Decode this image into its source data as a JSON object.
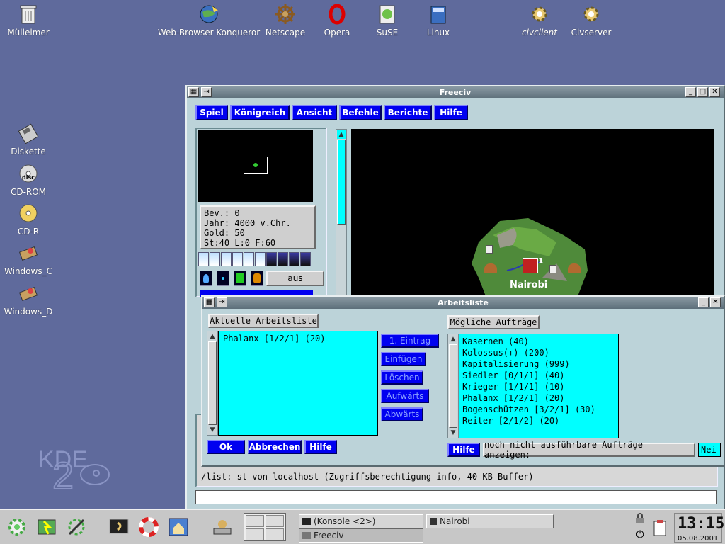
{
  "desktop": {
    "top_icons": [
      {
        "label": "Mülleimer",
        "icon": "trash-icon"
      },
      {
        "label": "Web-Browser Konqueror",
        "icon": "konqueror-icon"
      },
      {
        "label": "Netscape",
        "icon": "netscape-icon"
      },
      {
        "label": "Opera",
        "icon": "opera-icon"
      },
      {
        "label": "SuSE",
        "icon": "suse-icon"
      },
      {
        "label": "Linux",
        "icon": "folder-icon"
      },
      {
        "label": "civclient",
        "icon": "gear-icon"
      },
      {
        "label": "Civserver",
        "icon": "gear-icon"
      }
    ],
    "left_icons": [
      {
        "label": "Diskette",
        "icon": "floppy-icon"
      },
      {
        "label": "CD-ROM",
        "icon": "cdrom-icon"
      },
      {
        "label": "CD-R",
        "icon": "cdr-icon"
      },
      {
        "label": "Windows_C",
        "icon": "drive-icon"
      },
      {
        "label": "Windows_D",
        "icon": "drive-icon"
      }
    ]
  },
  "freeciv": {
    "title": "Freeciv",
    "menu": [
      "Spiel",
      "Königreich",
      "Ansicht",
      "Befehle",
      "Berichte",
      "Hilfe"
    ],
    "info": {
      "bev": "Bev.: 0",
      "jahr": "Jahr: 4000 v.Chr.",
      "gold": "Gold: 50",
      "tax": "St:40 L:0 F:60"
    },
    "aus_button": "aus",
    "city_name": "Nairobi",
    "city_size": "1",
    "log_lines": [
      "/list:  st von localhost (Zugriffsberechtigung info, 40 KB Buffer)"
    ],
    "input_value": ""
  },
  "worklist": {
    "title": "Arbeitsliste",
    "current_label": "Aktuelle Arbeitsliste",
    "current_items": [
      "Phalanx [1/2/1] (20)"
    ],
    "side_buttons": [
      "1. Eintrag",
      "Einfügen",
      "Löschen",
      "Aufwärts",
      "Abwärts"
    ],
    "possible_label": "Mögliche Aufträge",
    "possible_items": [
      "Kasernen (40)",
      "Kolossus(+) (200)",
      "Kapitalisierung (999)",
      "Siedler [0/1/1] (40)",
      "Krieger [1/1/1] (10)",
      "Phalanx [1/2/1] (20)",
      "Bogenschützen [3/2/1] (30)",
      "Reiter [2/1/2] (20)"
    ],
    "ok": "Ok",
    "cancel": "Abbrechen",
    "help_left": "Hilfe",
    "help_right": "Hilfe",
    "show_unavailable": "noch nicht ausführbare Aufträge anzeigen:",
    "toggle_value": "Nei"
  },
  "taskbar": {
    "tasks": [
      "(Konsole <2>)",
      "Nairobi",
      "Freeciv"
    ],
    "clock": "13:15",
    "date": "05.08.2001"
  }
}
